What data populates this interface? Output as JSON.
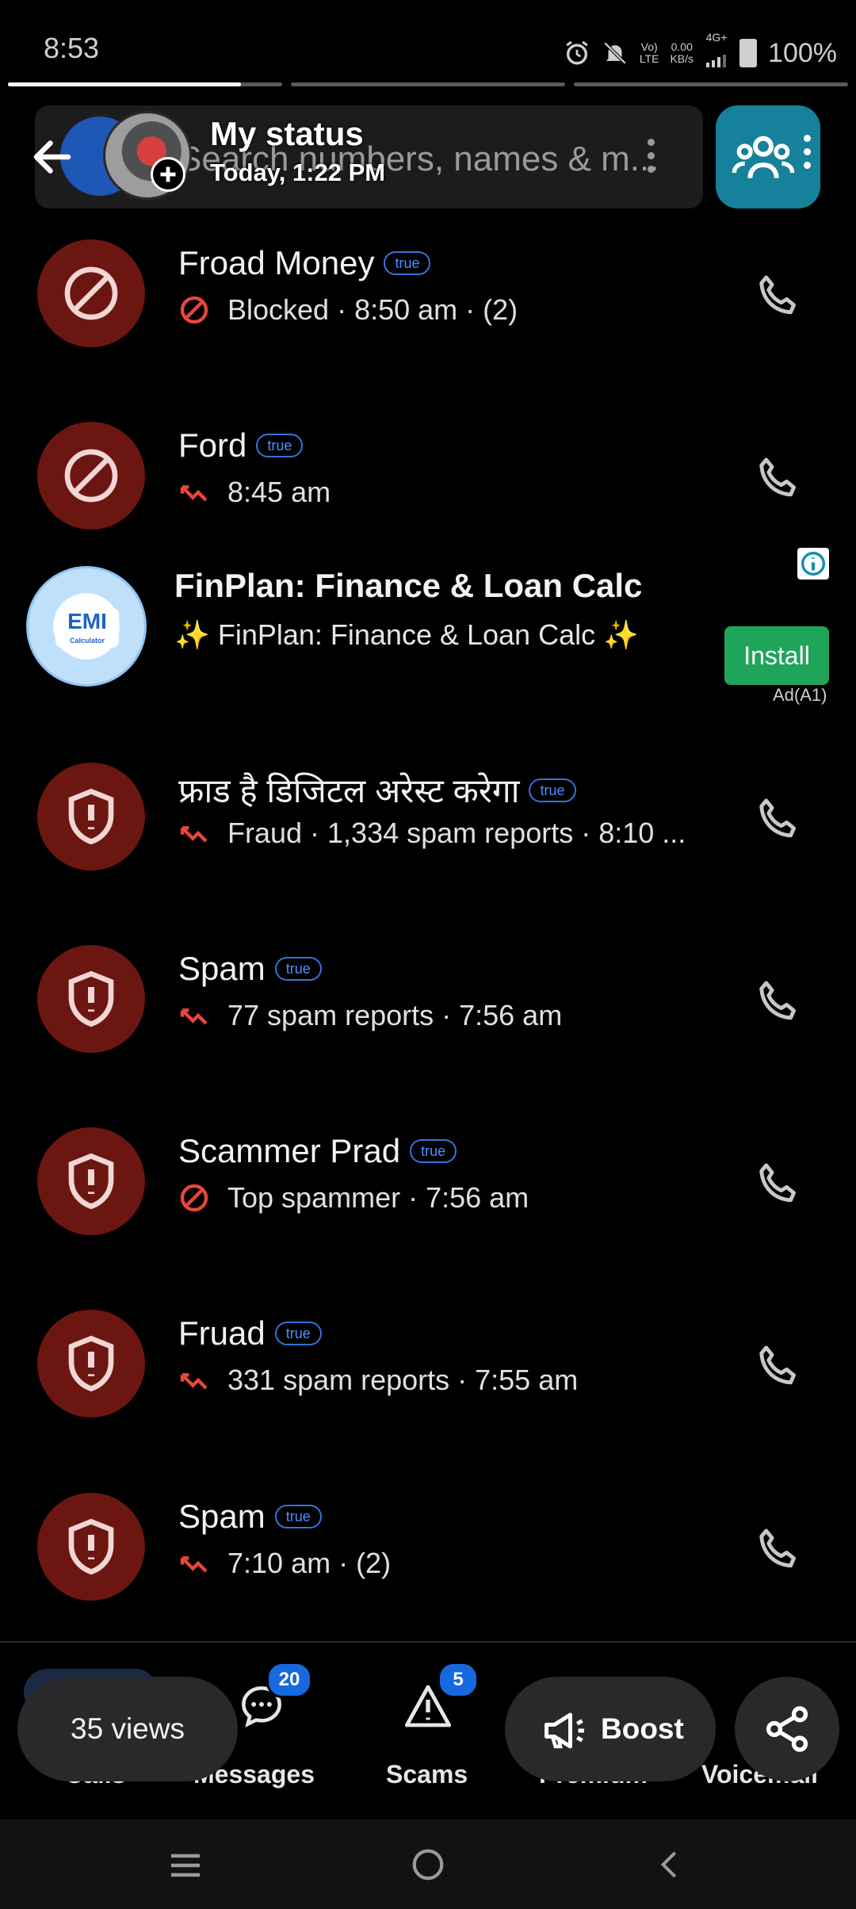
{
  "status_bar": {
    "time": "8:53",
    "net_top": "Vo)",
    "net_bottom": "LTE",
    "speed_top": "0.00",
    "speed_bottom": "KB/s",
    "signal": "4G+",
    "battery": "100%"
  },
  "story": {
    "progress_segments": [
      1,
      0,
      0
    ],
    "title": "My status",
    "time": "Today, 1:22 PM"
  },
  "search": {
    "placeholder": "Search numbers, names & m..."
  },
  "calls": [
    {
      "name": "Froad Money",
      "tag": "true",
      "status": "Blocked · 8:50 am · (2)",
      "icon": "blocked-icon",
      "avatar": "blocked-avatar-icon"
    },
    {
      "name": "Ford",
      "tag": "true",
      "status": "8:45 am",
      "icon": "missed-call-icon",
      "avatar": "blocked-avatar-icon"
    },
    {
      "name": "फ्राड है डिजिटल अरेस्ट करेगा",
      "tag": "true",
      "status": "Fraud · 1,334 spam reports · 8:10 ...",
      "icon": "missed-call-icon",
      "avatar": "shield-alert-icon"
    },
    {
      "name": "Spam",
      "tag": "true",
      "status": "77 spam reports · 7:56 am",
      "icon": "missed-call-icon",
      "avatar": "shield-alert-icon"
    },
    {
      "name": "Scammer Prad",
      "tag": "true",
      "status": "Top spammer · 7:56 am",
      "icon": "blocked-icon",
      "avatar": "shield-alert-icon"
    },
    {
      "name": "Fruad",
      "tag": "true",
      "status": "331 spam reports · 7:55 am",
      "icon": "missed-call-icon",
      "avatar": "shield-alert-icon"
    },
    {
      "name": "Spam",
      "tag": "true",
      "status": "7:10 am · (2)",
      "icon": "missed-call-icon",
      "avatar": "shield-alert-icon"
    }
  ],
  "ad": {
    "logo_text": "EMI",
    "logo_sub": "Calculator",
    "title": "FinPlan: Finance & Loan Calc",
    "subtitle": "✨ FinPlan: Finance & Loan Calc ✨",
    "install_label": "Install",
    "tag": "Ad(A1)"
  },
  "bottom_nav": {
    "items": [
      {
        "label": "Calls"
      },
      {
        "label": "Messages",
        "badge": "20"
      },
      {
        "label": "Scams",
        "badge": "5"
      },
      {
        "label": "Premium"
      },
      {
        "label": "Voicemail"
      }
    ]
  },
  "overlay": {
    "views": "35 views",
    "boost": "Boost"
  },
  "colors": {
    "avatar_red": "#6c1612",
    "icon_red": "#e8463c",
    "pill_blue": "#3672d9",
    "badge_blue": "#1769e0",
    "install_green": "#1fa55a"
  }
}
